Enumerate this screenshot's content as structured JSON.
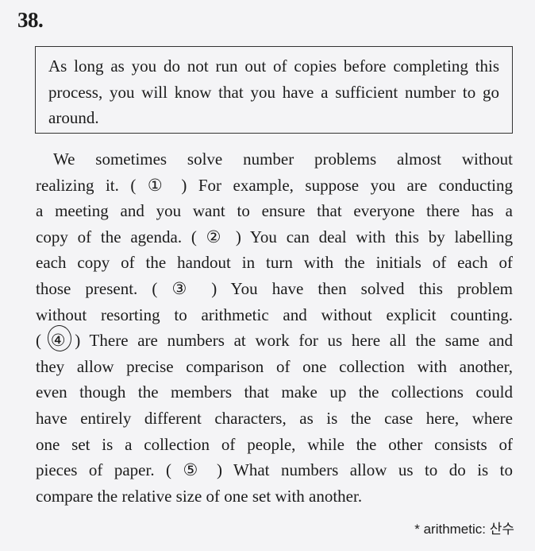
{
  "question_number": "38.",
  "given_sentence": "As long as you do not run out of copies before completing this process, you will know that you have a sufficient number to go around.",
  "passage": {
    "lines": [
      "We sometimes solve number problems almost without",
      "realizing it. ( ① ) For example, suppose you are conducting",
      "a meeting and you want to ensure that everyone there has a",
      "copy of the agenda. ( ② ) You can deal with this by labelling",
      "each copy of the handout in turn with the initials of each of",
      "those present. ( ③ ) You have then solved this problem",
      "without resorting to arithmetic and without explicit counting.",
      "( ④ ) There are numbers at work for us here all the same and",
      "they allow precise comparison of one collection with another,",
      "even though the members that make up the collections could",
      "have entirely different characters, as is the case here, where",
      "one set is a collection of people, while the other consists of",
      "pieces of paper. ( ⑤ ) What numbers allow us to do is to",
      "compare the relative size of one set with another."
    ]
  },
  "footnote": "* arithmetic: 산수",
  "colors": {
    "background": "#f4f4f6",
    "text": "#1c1c1c",
    "border": "#333333"
  }
}
